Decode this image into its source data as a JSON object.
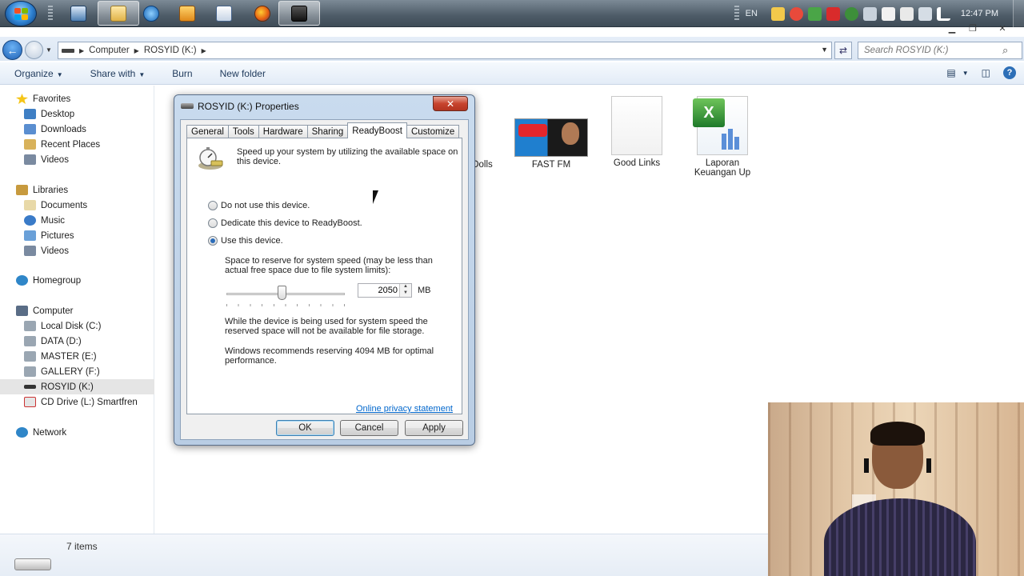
{
  "taskbar": {
    "language": "EN",
    "clock": "12:47 PM"
  },
  "address": {
    "crumbs": [
      "Computer",
      "ROSYID (K:)"
    ],
    "search_placeholder": "Search ROSYID (K:)"
  },
  "commandbar": {
    "organize": "Organize",
    "share_with": "Share with",
    "burn": "Burn",
    "new_folder": "New folder"
  },
  "nav": {
    "favorites": "Favorites",
    "desktop": "Desktop",
    "downloads": "Downloads",
    "recent_places": "Recent Places",
    "videos_fav": "Videos",
    "libraries": "Libraries",
    "documents": "Documents",
    "music": "Music",
    "pictures": "Pictures",
    "videos_lib": "Videos",
    "homegroup": "Homegroup",
    "computer": "Computer",
    "local_disk": "Local Disk (C:)",
    "data": "DATA (D:)",
    "master": "MASTER (E:)",
    "gallery": "GALLERY (F:)",
    "rosyid": "ROSYID (K:)",
    "cd_drive": "CD Drive (L:) Smartfren",
    "network": "Network"
  },
  "files": {
    "dolls": "Dolls",
    "fast_fm": "FAST FM",
    "good_links": "Good Links",
    "laporan": "Laporan Keuangan Up"
  },
  "status": {
    "items": "7 items"
  },
  "dialog": {
    "title": "ROSYID (K:) Properties",
    "close": "✕",
    "tabs": [
      "General",
      "Tools",
      "Hardware",
      "Sharing",
      "ReadyBoost",
      "Customize"
    ],
    "intro": "Speed up your system by utilizing the available space on this device.",
    "opt_none": "Do not use this device.",
    "opt_dedicate": "Dedicate this device to ReadyBoost.",
    "opt_use": "Use this device.",
    "reserve_label": "Space to reserve for system speed (may be less than actual free space due to file system limits):",
    "reserve_value": "2050",
    "reserve_unit": "MB",
    "slider_fraction": 0.47,
    "note_storage": "While the device is being used for system speed the reserved space will not be available for file storage.",
    "note_recommend": "Windows recommends reserving 4094 MB for optimal performance.",
    "privacy": "Online privacy statement",
    "ok": "OK",
    "cancel": "Cancel",
    "apply": "Apply"
  }
}
